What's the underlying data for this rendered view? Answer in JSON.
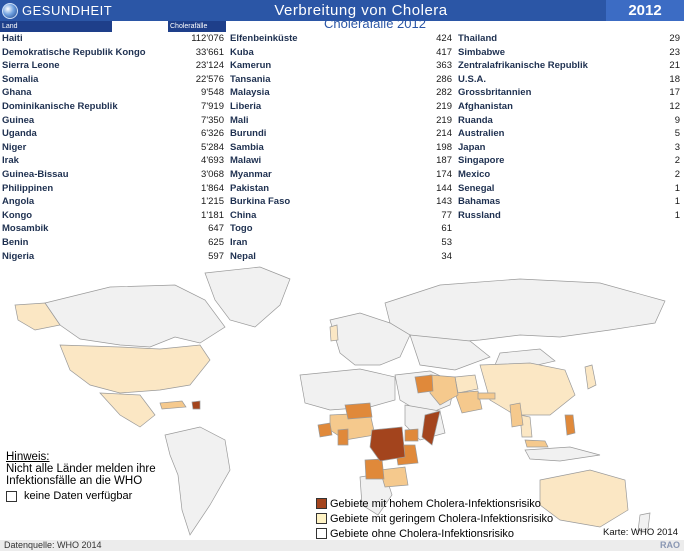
{
  "header": {
    "brand": "GESUNDHEIT",
    "title": "Verbreitung von  Cholera",
    "year": "2012"
  },
  "table_headers": {
    "land": "Land",
    "cases": "Cholerafälle"
  },
  "subtitle": "Cholerafälle 2012",
  "chart_data": {
    "type": "table",
    "title": "Cholerafälle 2012",
    "columns": [
      "Land",
      "Cholerafälle"
    ],
    "rows": [
      [
        "Haiti",
        "112'076"
      ],
      [
        "Demokratische Republik Kongo",
        "33'661"
      ],
      [
        "Sierra Leone",
        "23'124"
      ],
      [
        "Somalia",
        "22'576"
      ],
      [
        "Ghana",
        "9'548"
      ],
      [
        "Dominikanische Republik",
        "7'919"
      ],
      [
        "Guinea",
        "7'350"
      ],
      [
        "Uganda",
        "6'326"
      ],
      [
        "Niger",
        "5'284"
      ],
      [
        "Irak",
        "4'693"
      ],
      [
        "Guinea-Bissau",
        "3'068"
      ],
      [
        "Philippinen",
        "1'864"
      ],
      [
        "Angola",
        "1'215"
      ],
      [
        "Kongo",
        "1'181"
      ],
      [
        "Mosambik",
        "647"
      ],
      [
        "Benin",
        "625"
      ],
      [
        "Nigeria",
        "597"
      ],
      [
        "Elfenbeinküste",
        "424"
      ],
      [
        "Kuba",
        "417"
      ],
      [
        "Kamerun",
        "363"
      ],
      [
        "Tansania",
        "286"
      ],
      [
        "Malaysia",
        "282"
      ],
      [
        "Liberia",
        "219"
      ],
      [
        "Mali",
        "219"
      ],
      [
        "Burundi",
        "214"
      ],
      [
        "Sambia",
        "198"
      ],
      [
        "Malawi",
        "187"
      ],
      [
        "Myanmar",
        "174"
      ],
      [
        "Pakistan",
        "144"
      ],
      [
        "Burkina Faso",
        "143"
      ],
      [
        "China",
        "77"
      ],
      [
        "Togo",
        "61"
      ],
      [
        "Iran",
        "53"
      ],
      [
        "Nepal",
        "34"
      ],
      [
        "Thailand",
        "29"
      ],
      [
        "Simbabwe",
        "23"
      ],
      [
        "Zentralafrikanische Republik",
        "21"
      ],
      [
        "U.S.A.",
        "18"
      ],
      [
        "Grossbritannien",
        "17"
      ],
      [
        "Afghanistan",
        "12"
      ],
      [
        "Ruanda",
        "9"
      ],
      [
        "Australien",
        "5"
      ],
      [
        "Japan",
        "3"
      ],
      [
        "Singapore",
        "2"
      ],
      [
        "Mexico",
        "2"
      ],
      [
        "Senegal",
        "1"
      ],
      [
        "Bahamas",
        "1"
      ],
      [
        "Russland",
        "1"
      ]
    ]
  },
  "map": {
    "colors": {
      "high": "#a3441d",
      "medium": "#e0893a",
      "low": "#f5c98d",
      "verylow": "#fbe7c4",
      "none": "#f1f1f1",
      "ocean": "#ffffff",
      "border": "#9a9a9a"
    }
  },
  "note": {
    "heading": "Hinweis:",
    "line1": "Nicht alle Länder melden ihre",
    "line2": "Infektionsfälle an die WHO"
  },
  "nodata": "keine Daten verfügbar",
  "legend": {
    "high": "Gebiete mit hohem Cholera-Infektionsrisiko",
    "low": "Gebiete mit geringem Cholera-Infektionsrisiko",
    "none": "Gebiete ohne Cholera-Infektionsrisiko",
    "colors": {
      "high": "#a3441d",
      "low": "#fff3c4",
      "none": "#ffffff"
    }
  },
  "credit": "Karte: WHO 2014",
  "footer": {
    "source": "Datenquelle: WHO 2014",
    "agency": "RAO"
  }
}
